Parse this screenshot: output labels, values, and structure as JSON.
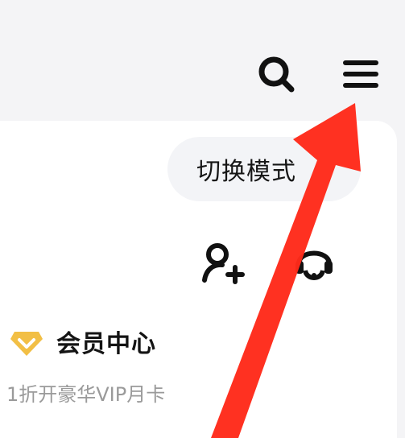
{
  "header": {
    "search_icon": "search-icon",
    "menu_icon": "hamburger-menu-icon"
  },
  "panel": {
    "mode_switch_label": "切换模式",
    "quick_actions": [
      {
        "icon": "add-friend-icon"
      },
      {
        "icon": "customer-service-icon"
      }
    ],
    "vip": {
      "icon": "vip-diamond-icon",
      "title": "会员中心",
      "subtitle": "1折开豪华VIP月卡"
    }
  },
  "annotation": {
    "arrow_color": "#ff2a1a",
    "points_to": "hamburger-menu-icon"
  },
  "colors": {
    "background": "#f4f4f6",
    "panel": "#ffffff",
    "pill": "#f3f4f7",
    "vip_gold": "#f2bf45",
    "text_primary": "#141414",
    "text_secondary": "#9a9a9a"
  }
}
